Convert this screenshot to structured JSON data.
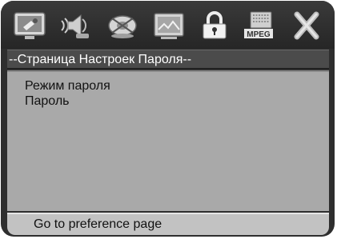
{
  "toolbar": {
    "icons": [
      {
        "name": "general-setup-icon"
      },
      {
        "name": "audio-setup-icon"
      },
      {
        "name": "dolby-setup-icon"
      },
      {
        "name": "video-setup-icon"
      },
      {
        "name": "password-lock-icon",
        "selected": true
      },
      {
        "name": "mpeg-setup-icon",
        "label": "MPEG"
      },
      {
        "name": "exit-icon"
      }
    ]
  },
  "title": "--Страница Настроек Пароля--",
  "menu": {
    "items": [
      {
        "label": "Режим пароля"
      },
      {
        "label": "Пароль"
      }
    ]
  },
  "status": "Go to preference page",
  "colors": {
    "frame": "#2e2e2e",
    "titlebar": "#4b4b4b",
    "content": "#a9a9a9",
    "statusbar": "#c2c2c2"
  }
}
